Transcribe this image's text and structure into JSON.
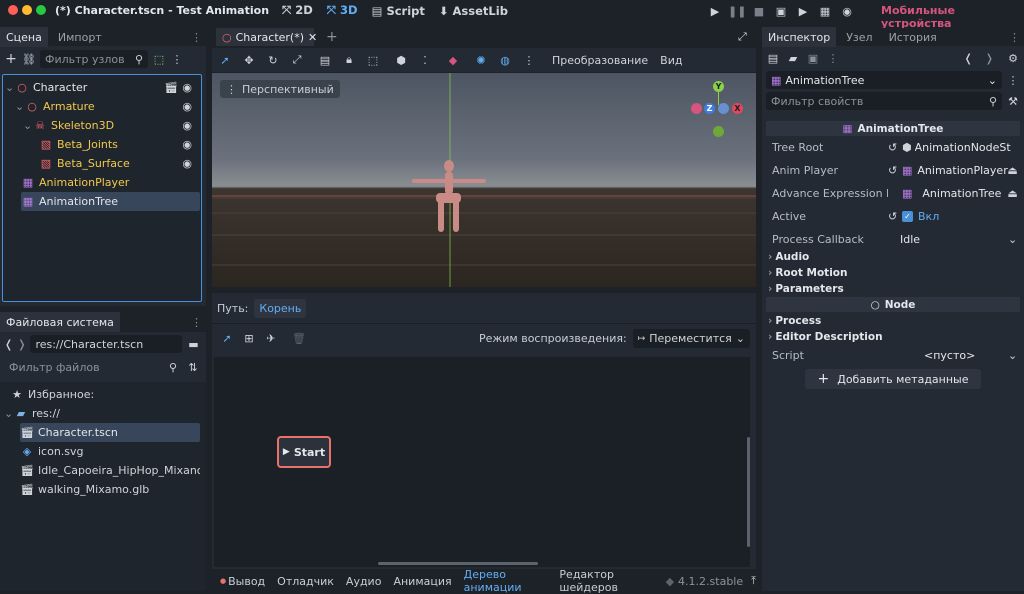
{
  "titlebar": {
    "title": "(*) Character.tscn - Test Animation",
    "modes": [
      "2D",
      "3D",
      "Script",
      "AssetLib"
    ],
    "active_mode": "3D",
    "platform": "Мобильные устройства",
    "platform_color": "#d6547e"
  },
  "scene_dock": {
    "tabs": [
      "Сцена",
      "Импорт"
    ],
    "filter_placeholder": "Фильтр узлов",
    "nodes": [
      {
        "label": "Character",
        "depth": 0,
        "color": "#e4e7eb",
        "icon": "node3d-icon"
      },
      {
        "label": "Armature",
        "depth": 1,
        "color": "#f2c94c",
        "icon": "node3d-icon"
      },
      {
        "label": "Skeleton3D",
        "depth": 2,
        "color": "#f2c94c",
        "icon": "skeleton-icon"
      },
      {
        "label": "Beta_Joints",
        "depth": 3,
        "color": "#f2c94c",
        "icon": "mesh-icon"
      },
      {
        "label": "Beta_Surface",
        "depth": 3,
        "color": "#f2c94c",
        "icon": "mesh-icon"
      },
      {
        "label": "AnimationPlayer",
        "depth": 1,
        "color": "#f2c94c",
        "icon": "animation-player-icon"
      },
      {
        "label": "AnimationTree",
        "depth": 1,
        "color": "#e4e7eb",
        "icon": "animation-tree-icon"
      }
    ]
  },
  "filesystem": {
    "tab": "Файловая система",
    "path": "res://Character.tscn",
    "filter_placeholder": "Фильтр файлов",
    "favorites": "Избранное:",
    "root": "res://",
    "files": [
      "Character.tscn",
      "icon.svg",
      "Idle_Capoeira_HipHop_Mixano....",
      "walking_Mixamo.glb"
    ]
  },
  "viewport": {
    "tab": "Character(*)",
    "transform_menu": "Преобразование",
    "view_menu": "Вид",
    "perspective": "Перспективный",
    "gizmo": {
      "y": "Y",
      "z": "Z",
      "x": "X"
    }
  },
  "anim_tree": {
    "path_label": "Путь:",
    "path_value": "Корень",
    "play_mode_label": "Режим воспроизведения:",
    "play_mode_value": "Переместится",
    "start_node": "Start"
  },
  "bottom_tabs": [
    "Вывод",
    "Отладчик",
    "Аудио",
    "Анимация",
    "Дерево анимации",
    "Редактор шейдеров"
  ],
  "active_bottom_tab": "Дерево анимации",
  "version": "4.1.2.stable",
  "inspector": {
    "tabs": [
      "Инспектор",
      "Узел",
      "История"
    ],
    "object": "AnimationTree",
    "filter_placeholder": "Фильтр свойств",
    "header": "AnimationTree",
    "props": [
      {
        "label": "Tree Root",
        "value": "AnimationNodeSt"
      },
      {
        "label": "Anim Player",
        "value": "AnimationPlayer"
      },
      {
        "label": "Advance Expression Ba...",
        "value": "AnimationTree"
      },
      {
        "label": "Active",
        "value": "Вкл"
      },
      {
        "label": "Process Callback",
        "value": "Idle"
      }
    ],
    "groups1": [
      "Audio",
      "Root Motion",
      "Parameters"
    ],
    "node_header": "Node",
    "groups2": [
      "Process",
      "Editor Description"
    ],
    "script_label": "Script",
    "script_value": "<пусто>",
    "add_meta": "Добавить метаданные"
  }
}
